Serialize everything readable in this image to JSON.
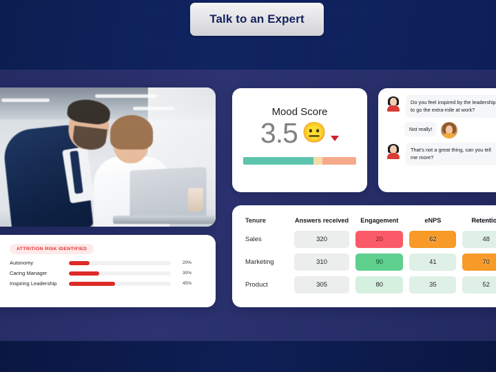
{
  "cta": {
    "label": "Talk to an Expert"
  },
  "photo_card": {
    "alt": "Two colleagues reviewing results on a laptop in a bright office"
  },
  "mood_card": {
    "title": "Mood Score",
    "value": "3.5",
    "emoji": "😐",
    "trend": "down",
    "trend_color": "#d0202c",
    "bar": [
      {
        "name": "positive",
        "color": "#5cc4ac",
        "pct": 62
      },
      {
        "name": "neutral",
        "color": "#f2dca7",
        "pct": 8
      },
      {
        "name": "negative",
        "color": "#f7a98b",
        "pct": 30
      }
    ]
  },
  "chat_card": {
    "messages": [
      {
        "sender": "bot",
        "avatar": "bot-avatar",
        "text": "Do you feel inspired by the leadership to go the extra-mile at work?"
      },
      {
        "sender": "user",
        "avatar": "user-avatar",
        "text": "Not really!"
      },
      {
        "sender": "bot",
        "avatar": "bot-avatar",
        "text": "That's not a great thing, can you tell me more?"
      }
    ]
  },
  "table_card": {
    "columns": [
      "Tenure",
      "Answers received",
      "Engagement",
      "eNPS",
      "Retention"
    ],
    "hidden_column_index": 4,
    "rows": [
      {
        "tenure": "Sales",
        "answers": "320",
        "engagement": {
          "value": "20",
          "color": "#fb5a68",
          "text_color": "#7d1721"
        },
        "enps": {
          "value": "62",
          "color": "#f79a27",
          "blurred": true
        },
        "extra": {
          "value": "48",
          "color": "#dff0e6",
          "blurred": true
        }
      },
      {
        "tenure": "Marketing",
        "answers": "310",
        "engagement": {
          "value": "90",
          "color": "#5fcf8e",
          "text_color": "#0f4f2c"
        },
        "enps": {
          "value": "41",
          "color": "#dff0e6",
          "blurred": true
        },
        "extra": {
          "value": "70",
          "color": "#f79a27",
          "blurred": true
        }
      },
      {
        "tenure": "Product",
        "answers": "305",
        "engagement": {
          "value": "80",
          "color": "#d6f0e0",
          "text_color": "#1d1d20"
        },
        "enps": {
          "value": "35",
          "color": "#dff0e6",
          "blurred": true
        },
        "extra": {
          "value": "52",
          "color": "#dff0e6",
          "blurred": true
        }
      }
    ],
    "answer_cell_color": "#eceded"
  },
  "attrition_card": {
    "badge": "ATTRITION RISK IDENTIFIED",
    "badge_bg": "#fdeaea",
    "badge_color": "#e0322f",
    "bar_color": "#dc2b28",
    "items": [
      {
        "label": "Autonomy",
        "pct": 20,
        "pct_label": "20%"
      },
      {
        "label": "Caring Manager",
        "pct": 30,
        "pct_label": "30%"
      },
      {
        "label": "Inspiring Leadership",
        "pct": 45,
        "pct_label": "45%"
      }
    ]
  },
  "theme": {
    "bg_top": "#0c1d50",
    "bg_mid": "#2c3370",
    "bg_bottom": "#0a1742",
    "cta_text": "#14225c"
  }
}
